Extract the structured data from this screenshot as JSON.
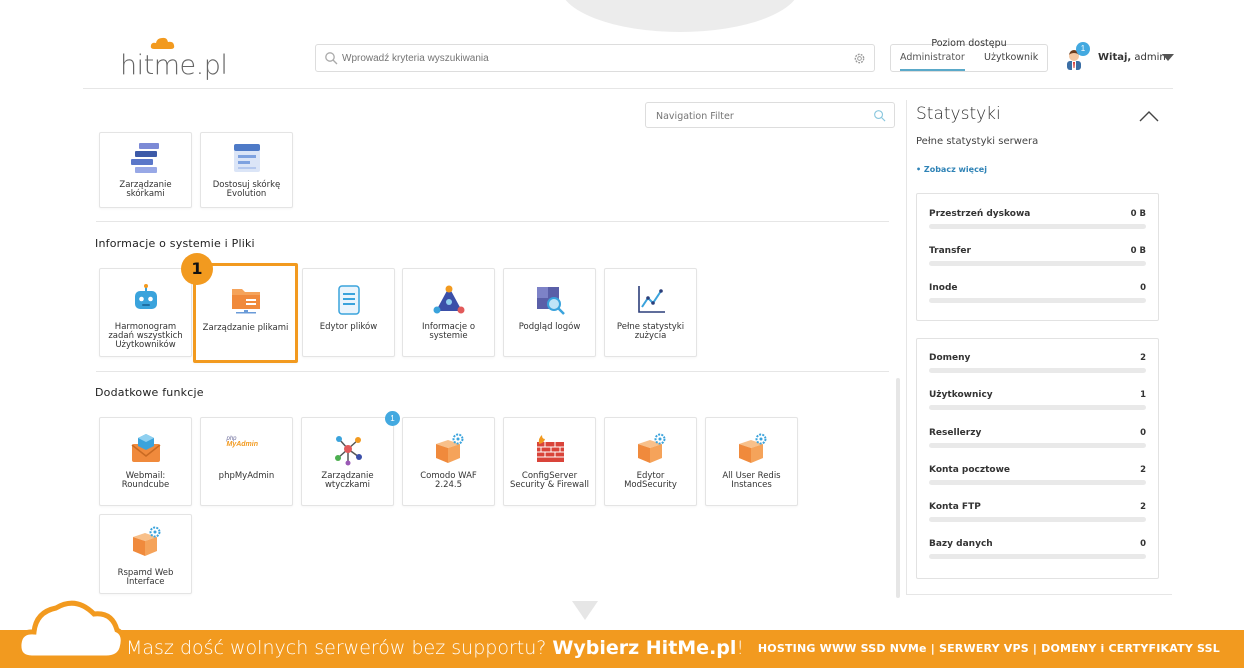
{
  "header": {
    "logo_text": "hitme.pl",
    "search_placeholder": "Wprowadź kryteria wyszukiwania",
    "access": {
      "title": "Poziom dostępu",
      "tabs": [
        "Administrator",
        "Użytkownik"
      ],
      "active": "Administrator"
    },
    "user": {
      "greeting": "Witaj,",
      "name": "admin",
      "badge": "1"
    }
  },
  "main": {
    "nav_filter_placeholder": "Navigation Filter",
    "top_cards": [
      {
        "label": "Zarządzanie skórkami",
        "icon": "skins-icon"
      },
      {
        "label": "Dostosuj skórkę Evolution",
        "icon": "customize-skin-icon"
      }
    ],
    "section1": {
      "title": "Informacje o systemie i Pliki",
      "step_badge": "1",
      "cards": [
        {
          "label": "Harmonogram zadań wszystkich Użytkowników",
          "icon": "robot-icon"
        },
        {
          "label": "Zarządzanie plikami",
          "icon": "folder-icon"
        },
        {
          "label": "Edytor plików",
          "icon": "file-editor-icon"
        },
        {
          "label": "Informacje o systemie",
          "icon": "system-info-icon"
        },
        {
          "label": "Podgląd logów",
          "icon": "log-viewer-icon"
        },
        {
          "label": "Pełne statystyki zużycia",
          "icon": "stats-chart-icon"
        }
      ]
    },
    "section2": {
      "title": "Dodatkowe funkcje",
      "notif_badge": "1",
      "cards": [
        {
          "label": "Webmail: Roundcube",
          "icon": "webmail-icon"
        },
        {
          "label": "phpMyAdmin",
          "icon": "phpmyadmin-icon",
          "logo_top": "php",
          "logo_bottom": "MyAdmin"
        },
        {
          "label": "Zarządzanie wtyczkami",
          "icon": "plugins-icon"
        },
        {
          "label": "Comodo WAF 2.24.5",
          "icon": "box-gear-icon"
        },
        {
          "label": "ConfigServer Security & Firewall",
          "icon": "firewall-icon"
        },
        {
          "label": "Edytor ModSecurity",
          "icon": "box-gear-icon"
        },
        {
          "label": "All User Redis Instances",
          "icon": "box-gear-icon"
        },
        {
          "label": "Rspamd Web Interface",
          "icon": "box-gear-icon"
        }
      ]
    }
  },
  "sidebar": {
    "title": "Statystyki",
    "subtitle": "Pełne statystyki serwera",
    "more_link": "• Zobacz więcej",
    "resources": [
      {
        "label": "Przestrzeń dyskowa",
        "value": "0 B",
        "fill": 0
      },
      {
        "label": "Transfer",
        "value": "0 B",
        "fill": 0
      },
      {
        "label": "Inode",
        "value": "0",
        "fill": 0
      }
    ],
    "counts": [
      {
        "label": "Domeny",
        "value": "2",
        "fill": 0
      },
      {
        "label": "Użytkownicy",
        "value": "1",
        "fill": 0
      },
      {
        "label": "Resellerzy",
        "value": "0",
        "fill": 0
      },
      {
        "label": "Konta pocztowe",
        "value": "2",
        "fill": 0
      },
      {
        "label": "Konta FTP",
        "value": "2",
        "fill": 0
      },
      {
        "label": "Bazy danych",
        "value": "0",
        "fill": 0
      }
    ]
  },
  "banner": {
    "text_light": "Masz dość wolnych serwerów bez supportu?",
    "text_bold": "Wybierz HitMe.pl",
    "text_end": "!",
    "right": "HOSTING WWW SSD NVMe | SERWERY VPS | DOMENY i CERTYFIKATY SSL"
  },
  "colors": {
    "accent": "#f29a1f",
    "link": "#2f83b6",
    "badge": "#43a9e0"
  }
}
